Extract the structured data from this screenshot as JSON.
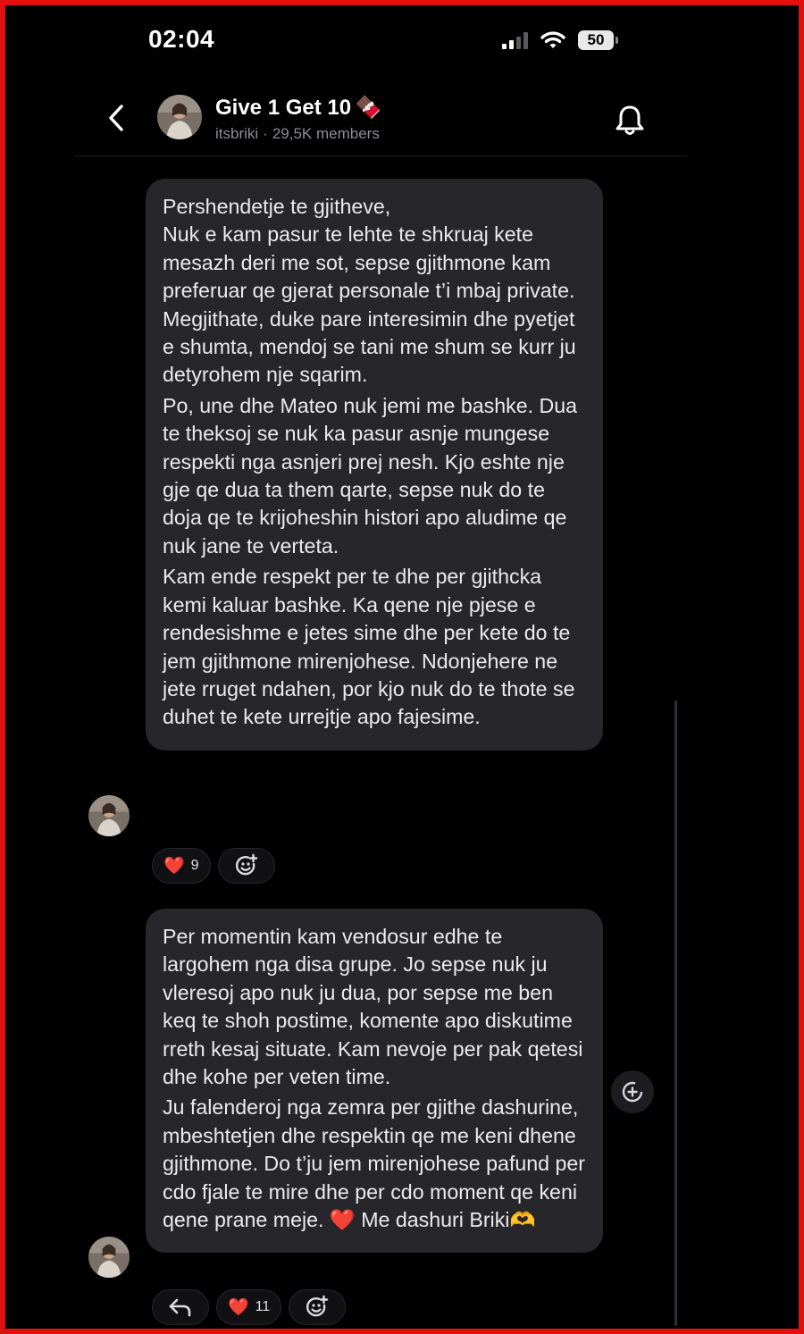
{
  "status_bar": {
    "time": "02:04",
    "battery": "50",
    "icons": [
      "cellular-signal-icon",
      "wifi-icon",
      "battery-icon"
    ]
  },
  "header": {
    "title": "Give 1 Get 10",
    "title_emoji": "🍫",
    "handle": "itsbriki",
    "separator": "·",
    "members": "29,5K members",
    "icons": [
      "back-chevron-icon",
      "channel-avatar",
      "bell-icon"
    ]
  },
  "messages": [
    {
      "paragraphs": [
        "Pershendetje te gjitheve,\nNuk e kam pasur te lehte te shkruaj kete mesazh deri me sot, sepse gjithmone kam preferuar qe gjerat personale t’i mbaj private. Megjithate, duke pare interesimin dhe pyetjet e shumta, mendoj se tani me shum se kurr ju detyrohem nje sqarim.",
        "Po, une dhe Mateo nuk jemi me bashke. Dua te theksoj se nuk ka pasur asnje mungese respekti nga asnjeri prej nesh. Kjo eshte nje gje qe dua ta them qarte, sepse nuk do te doja qe te krijoheshin histori apo aludime qe nuk jane te verteta.",
        "Kam ende respekt per te dhe per gjithcka kemi kaluar bashke. Ka qene nje pjese e rendesishme e jetes sime dhe per kete do te jem gjithmone mirenjohese. Ndonjehere ne jete rruget ndahen, por kjo nuk do te thote se duhet te kete urrejtje apo fajesime."
      ],
      "reactions": [
        {
          "emoji": "❤️",
          "count": "9"
        }
      ]
    },
    {
      "paragraphs": [
        "Per momentin kam vendosur edhe te largohem nga disa grupe. Jo sepse nuk ju vleresoj apo nuk ju dua, por sepse me ben keq te shoh postime, komente apo diskutime rreth kesaj situate. Kam nevoje per pak qetesi dhe kohe per veten time.",
        "Ju falenderoj nga zemra per gjithe dashurine, mbeshtetjen dhe respektin qe me keni dhene gjithmone. Do t’ju jem mirenjohese pafund per cdo fjale te mire dhe per cdo moment qe keni qene prane meje. ❤️ Me dashuri Briki🫶"
      ],
      "reactions": [
        {
          "emoji": "❤️",
          "count": "11"
        }
      ]
    }
  ],
  "colors": {
    "background": "#000000",
    "bubble": "#26262b",
    "frame": "#e01010",
    "heart": "#e8232f",
    "subtext": "#8d8d93"
  }
}
